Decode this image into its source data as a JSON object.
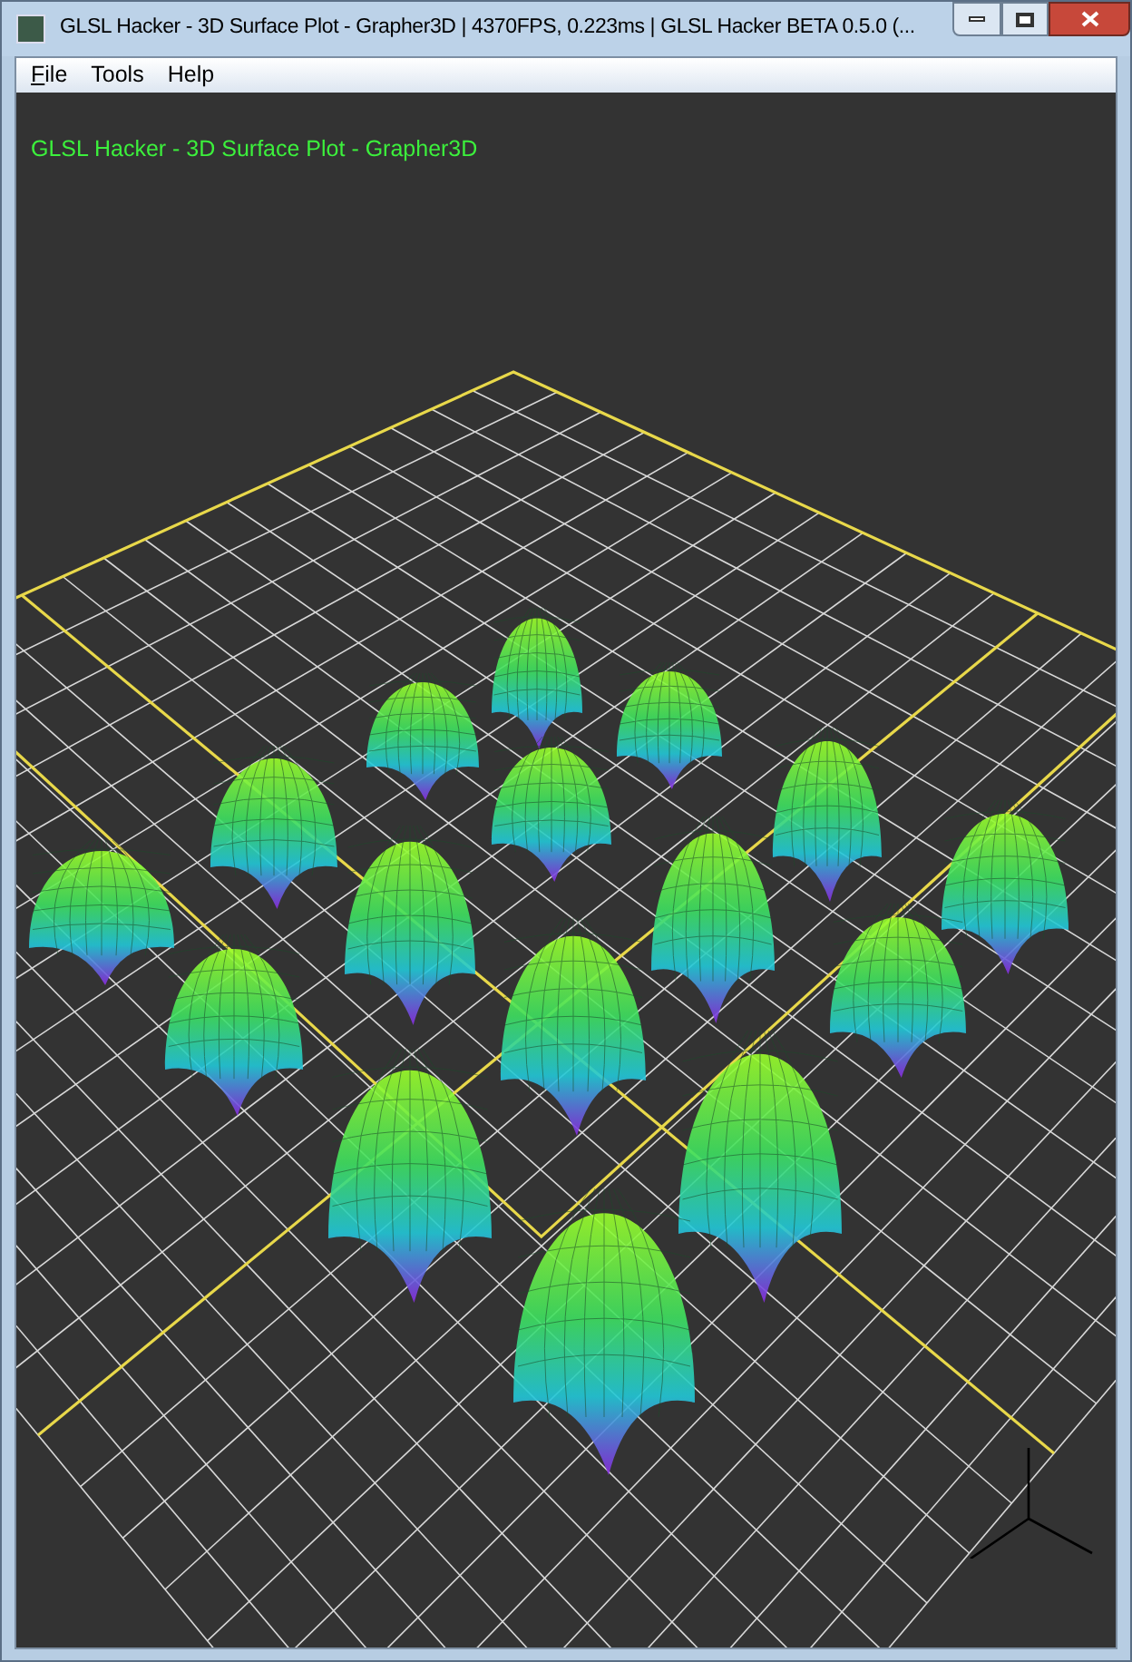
{
  "window": {
    "title": "GLSL Hacker - 3D Surface Plot - Grapher3D | 4370FPS, 0.223ms | GLSL Hacker BETA 0.5.0 (..."
  },
  "menu": [
    {
      "label": "File",
      "mnemonic": true
    },
    {
      "label": "Tools",
      "mnemonic": false
    },
    {
      "label": "Help",
      "mnemonic": false
    }
  ],
  "viewport": {
    "overlay_title": "GLSL Hacker - 3D Surface Plot - Grapher3D"
  }
}
